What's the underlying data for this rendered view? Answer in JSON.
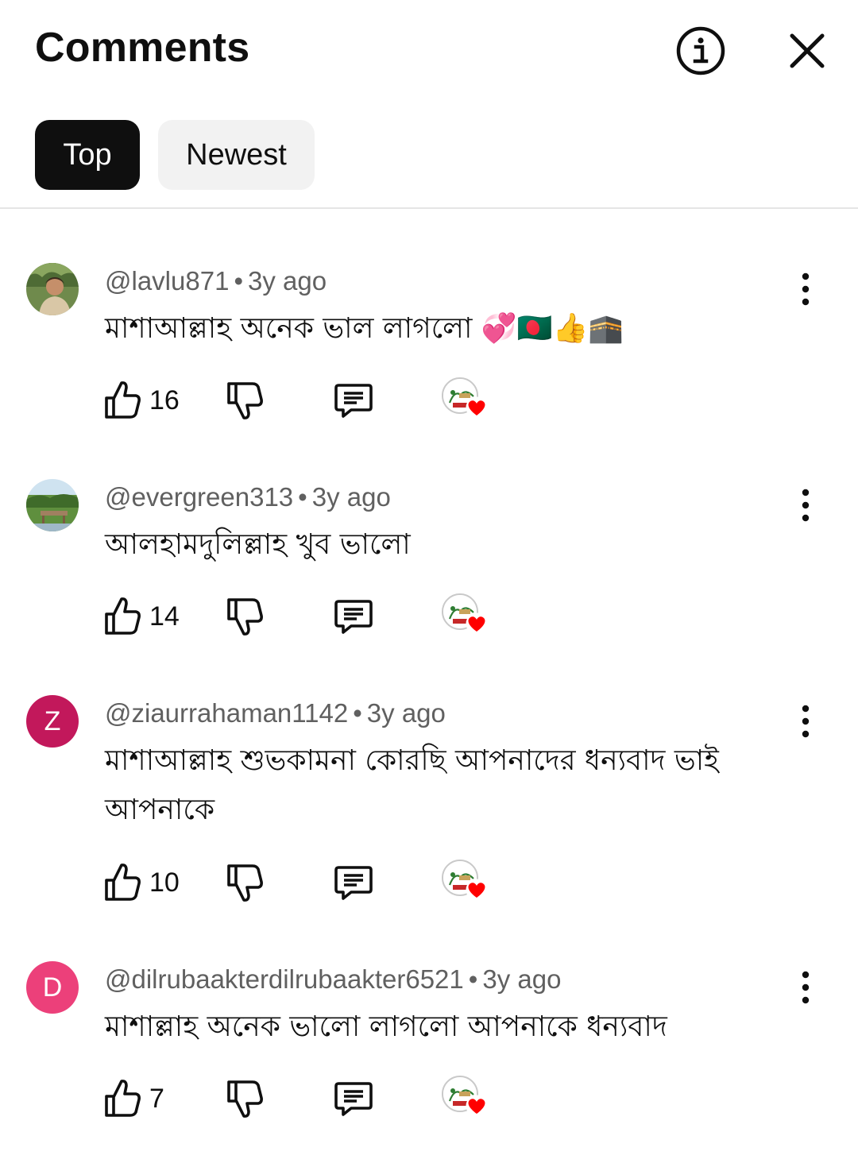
{
  "header": {
    "title": "Comments"
  },
  "tabs": [
    {
      "label": "Top",
      "active": true
    },
    {
      "label": "Newest",
      "active": false
    }
  ],
  "colors": {
    "heart": "#ff0000",
    "z_avatar": "#c2185b",
    "d_avatar": "#ec407a"
  },
  "comments": [
    {
      "author": "@lavlu871",
      "time": "3y ago",
      "text": "মাশাআল্লাহ অনেক ভাল লাগলো 💞🇧🇩👍🕋",
      "likes": "16",
      "avatar": "photo"
    },
    {
      "author": "@evergreen313",
      "time": "3y ago",
      "text": "আলহামদুলিল্লাহ খুব ভালো",
      "likes": "14",
      "avatar": "photo"
    },
    {
      "author": "@ziaurrahaman1142",
      "time": "3y ago",
      "text": "মাশাআল্লাহ শুভকামনা কোরছি আপনাদের ধন্যবাদ ভাই আপনাকে",
      "likes": "10",
      "avatar_letter": "Z"
    },
    {
      "author": "@dilrubaakterdilrubaakter6521",
      "time": "3y ago",
      "text": "মাশাল্লাহ অনেক ভালো লাগলো আপনাকে ধন্যবাদ",
      "likes": "7",
      "avatar_letter": "D"
    }
  ]
}
